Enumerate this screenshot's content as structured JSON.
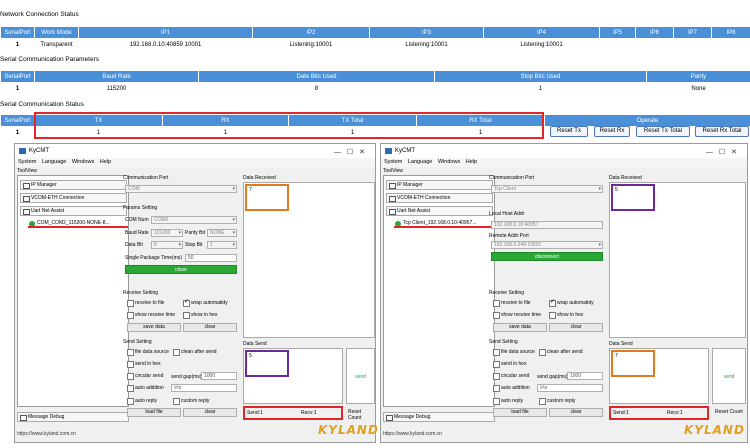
{
  "network": {
    "title": "Network Connection Status",
    "headers": [
      "SerialPort",
      "Work Mode",
      "IP1",
      "IP2",
      "IP3",
      "IP4",
      "IP5",
      "IP6",
      "IP7",
      "IP8"
    ],
    "row": [
      "1",
      "Transparent",
      "192.168.0.10:40859 10001",
      "Listening:10001",
      "Listening:10001",
      "Listening:10001",
      "",
      "",
      "",
      ""
    ]
  },
  "serial_params": {
    "title": "Serial Communication Parameters",
    "headers": [
      "SerialPort",
      "Baud Rate",
      "Date Bits Used",
      "Stop Bits Used",
      "Parity"
    ],
    "row": [
      "1",
      "115200",
      "8",
      "1",
      "None"
    ]
  },
  "serial_status": {
    "title": "Serial Communication Status",
    "headers": [
      "SerialPort",
      "TX",
      "RX",
      "TX Total",
      "RX Total",
      "Operate"
    ],
    "row": [
      "1",
      "1",
      "1",
      "1",
      "1"
    ],
    "buttons": [
      "Reset Tx",
      "Reset Rx",
      "Reset Tx Total",
      "Reset Rx Total"
    ]
  },
  "left_app": {
    "title": "KyCMT",
    "menu": [
      "System",
      "Language",
      "Windows",
      "Help"
    ],
    "toolview": "ToolView",
    "tree": [
      "IP Manager",
      "VCOM-ETH Connection",
      "Uart Net Assist"
    ],
    "connection": "COM_COM2_115200-NONE-8...",
    "message_debug": "Message Debug",
    "comm_port_label": "Communication Port",
    "comm_port_value": "COM",
    "params_label": "Params Setting",
    "com_num_label": "COM Num",
    "com_num_value": "COM2",
    "baud_label": "Baud Rate",
    "baud_value": "115200",
    "parity_label": "Parity Bit",
    "parity_value": "NONE",
    "databit_label": "Data Bit",
    "databit_value": "8",
    "stopbit_label": "Stop Bit",
    "stopbit_value": "1",
    "single_pkg_label": "Single Package Time(ms)",
    "single_pkg_value": "50",
    "close_btn": "close",
    "receive_setting": "Receive Setting",
    "receive_to_file": "receive to file",
    "wrap_auto": "wrap automatidy",
    "show_receive_time": "show receive time",
    "show_in_hex": "show in hex",
    "save_data": "save data",
    "clear": "clear",
    "send_setting": "Send Setting",
    "file_data_source": "file data source",
    "clean_after_send": "clean after send",
    "send_in_hex": "send in hex",
    "circular_send": "circular send",
    "send_gap_label": "send gap(ms)",
    "send_gap_value": "1000",
    "auto_addition": "auto addition",
    "auto_addition_value": "\\r\\n",
    "auto_reply": "auto reply",
    "custom_reply": "custom reply",
    "load_file": "load file",
    "clear2": "clear",
    "data_received": "Data Received",
    "received_text": "7",
    "data_send": "Data Send",
    "send_text": "5",
    "send_btn": "send",
    "send_count": "Send:1",
    "recv_count": "Recv:1",
    "reset_count": "Reset Count",
    "url": "https://www.kyland.com.cn",
    "logo": "KYLAND"
  },
  "right_app": {
    "title": "KyCMT",
    "menu": [
      "System",
      "Language",
      "Windows",
      "Help"
    ],
    "toolview": "ToolView",
    "tree": [
      "IP Manager",
      "VCOM-ETH Connection",
      "Uart Net Assist"
    ],
    "connection": "Tcp Client_192.168.0.10:40957...",
    "message_debug": "Message Debug",
    "comm_port_label": "Communication Port",
    "comm_port_value": "Tcp Client",
    "local_host_label": "Local Host Addr",
    "local_host_value": "192.168.0.10:40957",
    "remote_label": "Remote Addr:Port",
    "remote_value": "192.168.0.248:10001",
    "disconnect_btn": "disconnect",
    "receive_setting": "Receive Setting",
    "receive_to_file": "receive to file",
    "wrap_auto": "wrap automatidy",
    "show_receive_time": "show receive time",
    "show_in_hex": "show in hex",
    "save_data": "save data",
    "clear": "clear",
    "send_setting": "Send Setting",
    "file_data_source": "file data source",
    "clean_after_send": "clean after send",
    "send_in_hex": "send in hex",
    "circular_send": "circular send",
    "send_gap_label": "send gap(ms)",
    "send_gap_value": "1000",
    "auto_addition": "auto addition",
    "auto_addition_value": "\\r\\n",
    "auto_reply": "auto reply",
    "custom_reply": "custom reply",
    "load_file": "load file",
    "clear2": "clear",
    "data_received": "Data Received",
    "received_text": "5",
    "data_send": "Data Send",
    "send_text": "7",
    "send_btn": "send",
    "send_count": "Send:1",
    "recv_count": "Recv:1",
    "reset_count": "Reset Count",
    "url": "https://www.kyland.com.cn",
    "logo": "KYLAND"
  },
  "colors": {
    "header_blue": "#4a90d9",
    "highlight_red": "#e0262b",
    "green": "#2aa836",
    "orange": "#e07b1f",
    "purple": "#6a2a9a"
  }
}
